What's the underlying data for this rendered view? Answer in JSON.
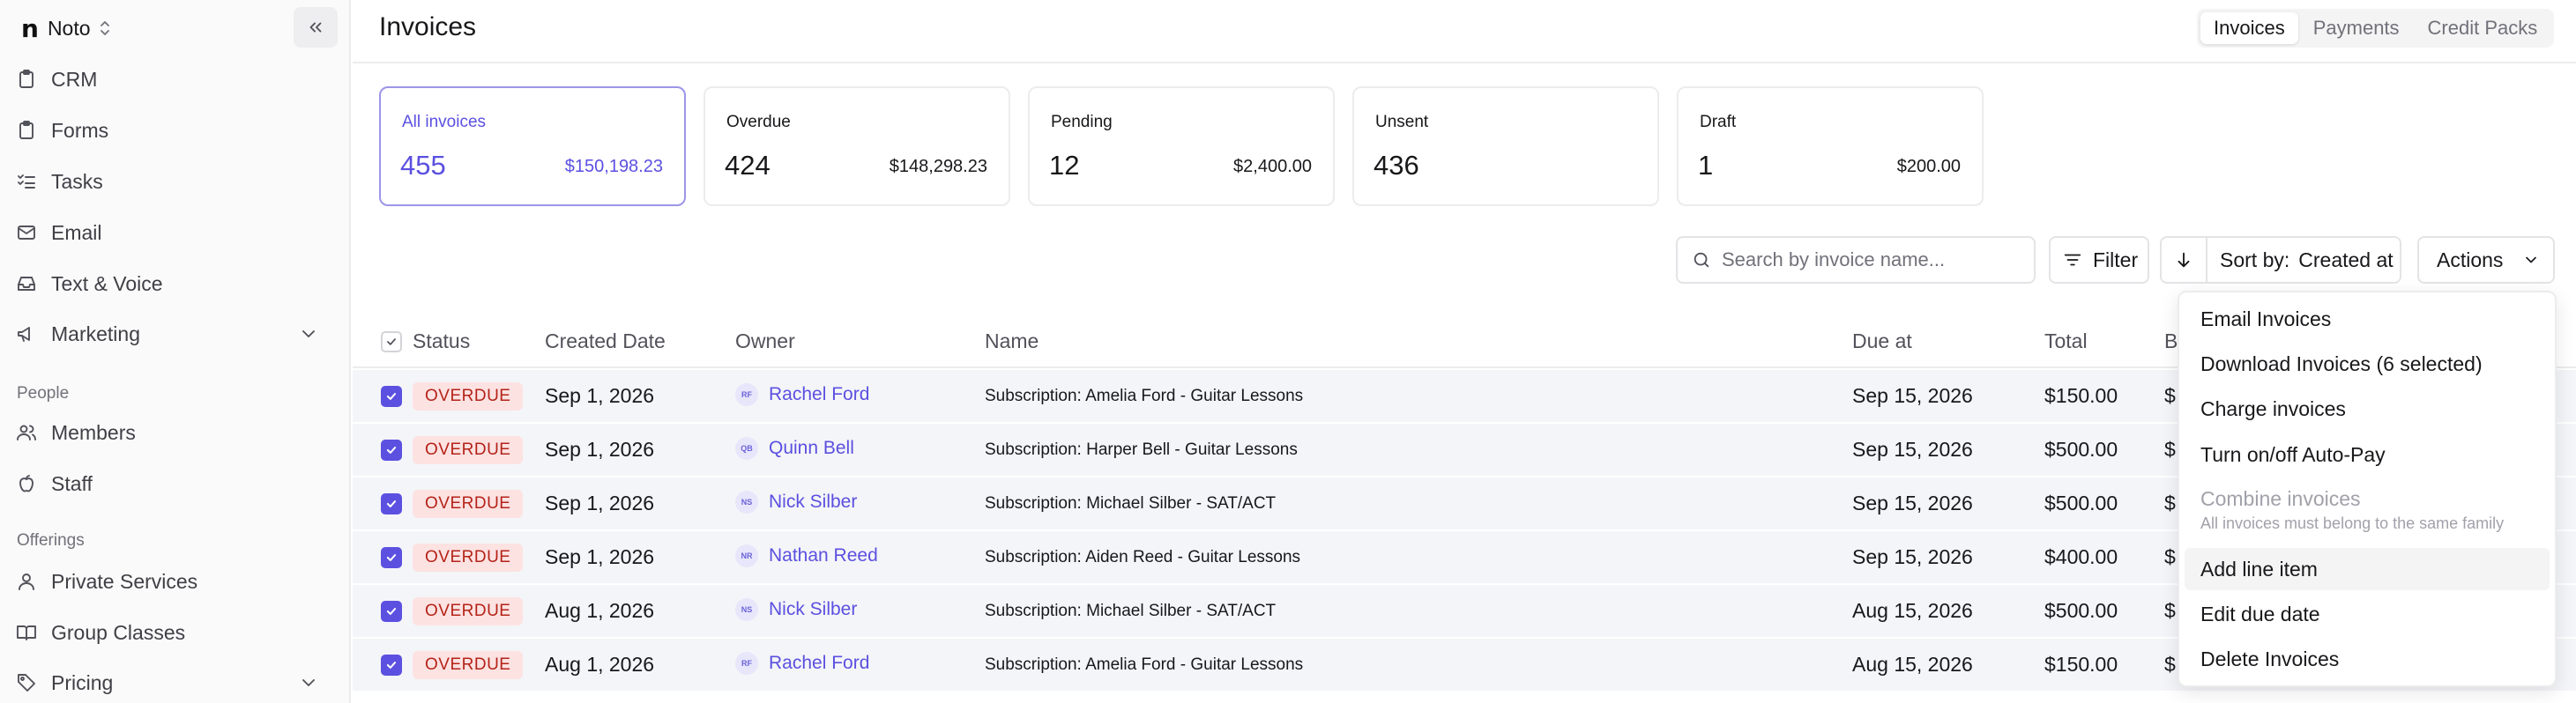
{
  "sidebar": {
    "brand": {
      "logo": "n",
      "name": "Noto"
    },
    "items": [
      {
        "label": "CRM",
        "icon": "clipboard-icon"
      },
      {
        "label": "Forms",
        "icon": "clipboard-icon"
      },
      {
        "label": "Tasks",
        "icon": "checklist-icon"
      },
      {
        "label": "Email",
        "icon": "mail-icon"
      },
      {
        "label": "Text & Voice",
        "icon": "inbox-icon"
      },
      {
        "label": "Marketing",
        "icon": "megaphone-icon"
      },
      {
        "label": "Members",
        "icon": "users-icon"
      },
      {
        "label": "Staff",
        "icon": "apple-icon"
      },
      {
        "label": "Private Services",
        "icon": "user-icon"
      },
      {
        "label": "Group Classes",
        "icon": "book-icon"
      },
      {
        "label": "Pricing",
        "icon": "tag-icon"
      }
    ],
    "sections": {
      "people": "People",
      "offerings": "Offerings"
    }
  },
  "header": {
    "title": "Invoices",
    "tabs": [
      {
        "label": "Invoices",
        "active": true
      },
      {
        "label": "Payments",
        "active": false
      },
      {
        "label": "Credit Packs",
        "active": false
      }
    ]
  },
  "summary_cards": [
    {
      "label": "All invoices",
      "count": "455",
      "amount": "$150,198.23",
      "active": true
    },
    {
      "label": "Overdue",
      "count": "424",
      "amount": "$148,298.23",
      "active": false
    },
    {
      "label": "Pending",
      "count": "12",
      "amount": "$2,400.00",
      "active": false
    },
    {
      "label": "Unsent",
      "count": "436",
      "amount": "",
      "active": false
    },
    {
      "label": "Draft",
      "count": "1",
      "amount": "$200.00",
      "active": false
    }
  ],
  "toolbar": {
    "search_placeholder": "Search by invoice name...",
    "filter_label": "Filter",
    "sort_prefix": "Sort by:",
    "sort_value": "Created at",
    "actions_label": "Actions"
  },
  "table": {
    "columns": {
      "status": "Status",
      "created": "Created Date",
      "owner": "Owner",
      "name": "Name",
      "due": "Due at",
      "total": "Total",
      "balance": "B"
    },
    "rows": [
      {
        "status": "OVERDUE",
        "created": "Sep 1, 2026",
        "owner_initials": "RF",
        "owner": "Rachel Ford",
        "name": "Subscription: Amelia Ford - Guitar Lessons",
        "due": "Sep 15, 2026",
        "total": "$150.00",
        "balance": "$"
      },
      {
        "status": "OVERDUE",
        "created": "Sep 1, 2026",
        "owner_initials": "QB",
        "owner": "Quinn Bell",
        "name": "Subscription: Harper Bell - Guitar Lessons",
        "due": "Sep 15, 2026",
        "total": "$500.00",
        "balance": "$"
      },
      {
        "status": "OVERDUE",
        "created": "Sep 1, 2026",
        "owner_initials": "NS",
        "owner": "Nick Silber",
        "name": "Subscription: Michael Silber - SAT/ACT",
        "due": "Sep 15, 2026",
        "total": "$500.00",
        "balance": "$"
      },
      {
        "status": "OVERDUE",
        "created": "Sep 1, 2026",
        "owner_initials": "NR",
        "owner": "Nathan Reed",
        "name": "Subscription: Aiden Reed - Guitar Lessons",
        "due": "Sep 15, 2026",
        "total": "$400.00",
        "balance": "$"
      },
      {
        "status": "OVERDUE",
        "created": "Aug 1, 2026",
        "owner_initials": "NS",
        "owner": "Nick Silber",
        "name": "Subscription: Michael Silber - SAT/ACT",
        "due": "Aug 15, 2026",
        "total": "$500.00",
        "balance": "$"
      },
      {
        "status": "OVERDUE",
        "created": "Aug 1, 2026",
        "owner_initials": "RF",
        "owner": "Rachel Ford",
        "name": "Subscription: Amelia Ford - Guitar Lessons",
        "due": "Aug 15, 2026",
        "total": "$150.00",
        "balance": "$"
      }
    ]
  },
  "actions_menu": {
    "items": [
      {
        "label": "Email Invoices"
      },
      {
        "label": "Download Invoices (6 selected)"
      },
      {
        "label": "Charge invoices"
      },
      {
        "label": "Turn on/off Auto-Pay"
      },
      {
        "label": "Combine invoices",
        "disabled": true,
        "note": "All invoices must belong to the same family"
      },
      {
        "label": "Add line item",
        "highlighted": true
      },
      {
        "label": "Edit due date"
      },
      {
        "label": "Delete Invoices"
      }
    ]
  },
  "colors": {
    "accent": "#5b50e0",
    "overdue_bg": "#fde2e2",
    "overdue_text": "#b42318",
    "row_bg": "#f4f5f8"
  }
}
